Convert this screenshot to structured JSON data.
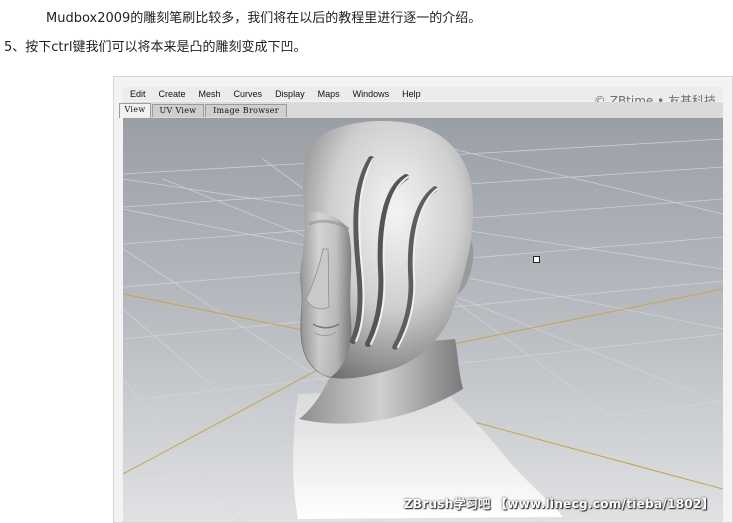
{
  "article": {
    "line1": "Mudbox2009的雕刻笔刷比较多，我们将在以后的教程里进行逐一的介绍。",
    "line2": "5、按下ctrl键我们可以将本来是凸的雕刻变成下凹。"
  },
  "app": {
    "menu": [
      "Edit",
      "Create",
      "Mesh",
      "Curves",
      "Display",
      "Maps",
      "Windows",
      "Help"
    ],
    "tabs": [
      "View",
      "UV View",
      "Image Browser"
    ],
    "active_tab": "View",
    "copyright": "© ZBtime • 友基科技",
    "watermark": "ZBrush学习吧 【www.linecg.com/tieba/1802】"
  },
  "colors": {
    "viewport_top": "#9a9fa6",
    "viewport_bottom": "#e1e2e4",
    "grid_axis": "#b89a3a"
  }
}
